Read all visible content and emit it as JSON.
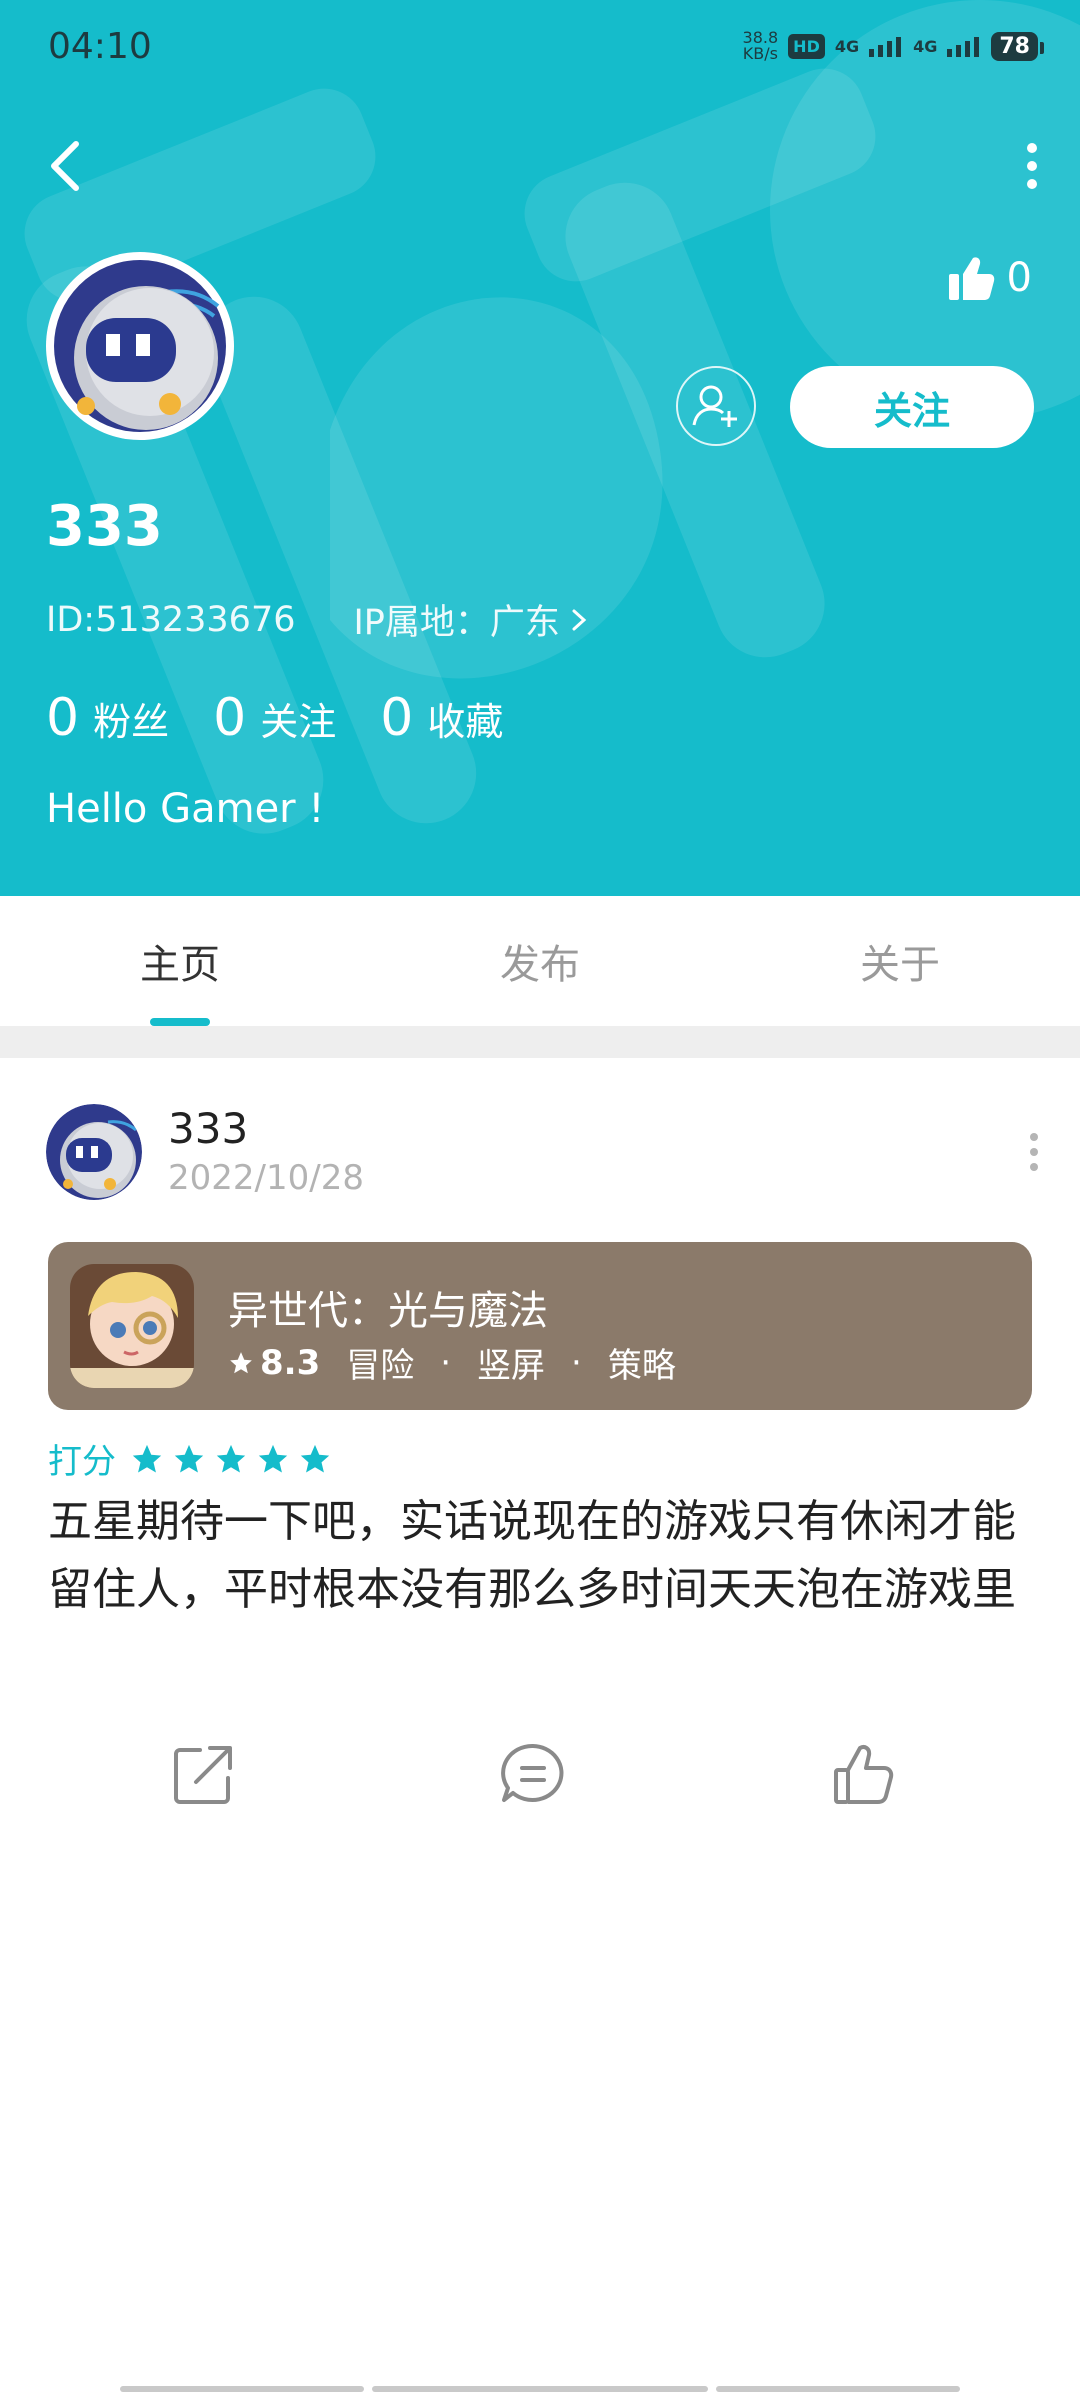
{
  "status_bar": {
    "time": "04:10",
    "net_speed_value": "38.8",
    "net_speed_unit": "KB/s",
    "hd_badge": "HD",
    "sim1_label": "4G",
    "sim2_label": "4G",
    "battery": "78"
  },
  "profile": {
    "likes": "0",
    "follow_label": "关注",
    "username": "333",
    "id_text": "ID:513233676",
    "ip_text": "IP属地：广东",
    "stats": [
      {
        "num": "0",
        "label": "粉丝"
      },
      {
        "num": "0",
        "label": "关注"
      },
      {
        "num": "0",
        "label": "收藏"
      }
    ],
    "bio": "Hello Gamer !"
  },
  "tabs": [
    {
      "label": "主页",
      "active": true
    },
    {
      "label": "发布",
      "active": false
    },
    {
      "label": "关于",
      "active": false
    }
  ],
  "post": {
    "username": "333",
    "date": "2022/10/28",
    "game": {
      "name": "异世代：光与魔法",
      "score": "8.3",
      "tags": [
        "冒险",
        "竖屏",
        "策略"
      ],
      "card_color": "#8b7a6a"
    },
    "rating_label": "打分",
    "rating_stars": 5,
    "text": "五星期待一下吧，实话说现在的游戏只有休闲才能留住人，平时根本没有那么多时间天天泡在游戏里"
  },
  "colors": {
    "accent": "#15bccb",
    "header_bg": "#15bccb"
  }
}
